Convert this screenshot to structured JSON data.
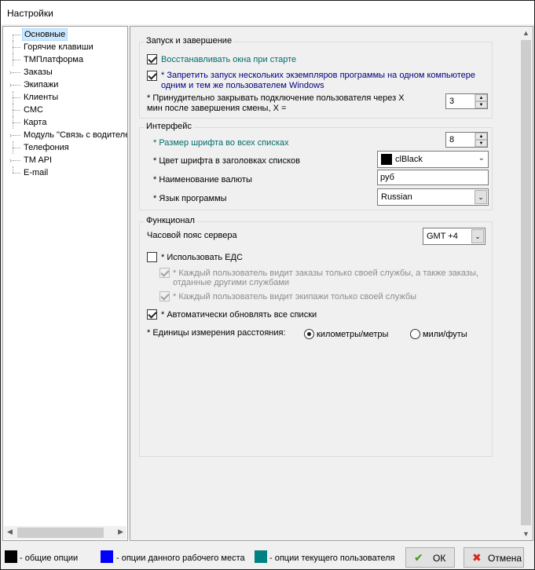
{
  "window": {
    "title": "Настройки"
  },
  "tree": {
    "items": [
      {
        "label": "Основные",
        "selected": true,
        "expandable": false
      },
      {
        "label": "Горячие клавиши",
        "selected": false,
        "expandable": false
      },
      {
        "label": "ТМПлатформа",
        "selected": false,
        "expandable": false
      },
      {
        "label": "Заказы",
        "selected": false,
        "expandable": true
      },
      {
        "label": "Экипажи",
        "selected": false,
        "expandable": true
      },
      {
        "label": "Клиенты",
        "selected": false,
        "expandable": false
      },
      {
        "label": "СМС",
        "selected": false,
        "expandable": false
      },
      {
        "label": "Карта",
        "selected": false,
        "expandable": false
      },
      {
        "label": "Модуль \"Связь с водителем\"",
        "selected": false,
        "expandable": true
      },
      {
        "label": "Телефония",
        "selected": false,
        "expandable": false
      },
      {
        "label": "TM API",
        "selected": false,
        "expandable": true
      },
      {
        "label": "E-mail",
        "selected": false,
        "expandable": false
      }
    ]
  },
  "startup": {
    "title": "Запуск и завершение",
    "restore_windows": {
      "label": "Восстанавливать окна при старте",
      "checked": true
    },
    "single_instance": {
      "label": "* Запретить запуск нескольких экземпляров программы на одном компьютере одним и тем же пользователем Windows",
      "line1": "* Запретить запуск нескольких экземпляров программы на одном компьютере",
      "line2": "одним и тем же пользователем Windows",
      "checked": true
    },
    "force_close": {
      "line1": "* Принудительно закрывать подключение пользователя через X",
      "line2": "мин после завершения смены, X =",
      "value": "3"
    }
  },
  "interface": {
    "title": "Интерфейс",
    "font_size": {
      "label": "* Размер шрифта во всех списках",
      "value": "8"
    },
    "header_color": {
      "label": "* Цвет шрифта в заголовках списков",
      "value": "clBlack"
    },
    "currency": {
      "label": "* Наименование валюты",
      "value": "руб"
    },
    "language": {
      "label": "* Язык программы",
      "value": "Russian"
    }
  },
  "functional": {
    "title": "Функционал",
    "timezone": {
      "label": "Часовой пояс сервера",
      "value": "GMT +4"
    },
    "use_eds": {
      "label": "* Использовать ЕДС",
      "checked": false
    },
    "own_orders": {
      "line1": "* Каждый пользователь видит заказы только своей службы, а также заказы,",
      "line2": "отданные другими службами",
      "checked": true
    },
    "own_crews": {
      "label": "* Каждый пользователь видит экипажи только своей службы",
      "checked": true
    },
    "auto_refresh": {
      "label": "* Автоматически обновлять все списки",
      "checked": true
    },
    "units": {
      "label": "* Единицы измерения расстояния:",
      "options": [
        "километры/метры",
        "мили/футы"
      ],
      "selected": "километры/метры"
    }
  },
  "footer": {
    "legend": [
      {
        "label": "- общие опции",
        "color": "#000000"
      },
      {
        "label": "- опции данного рабочего места",
        "color": "#0000ff"
      },
      {
        "label": "- опции текущего пользователя",
        "color": "#008080"
      }
    ],
    "ok_label": "ОК",
    "cancel_label": "Отмена"
  }
}
